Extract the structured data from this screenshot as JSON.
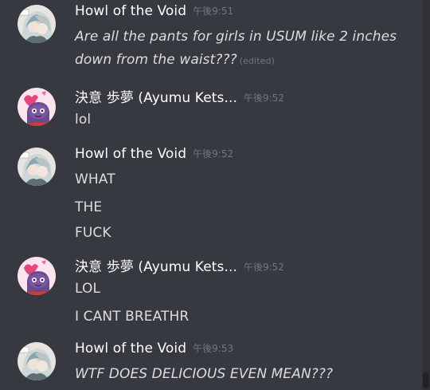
{
  "colors": {
    "background": "#36393f",
    "username": "#ffffff",
    "text": "#dcddde",
    "timestamp": "#72767d"
  },
  "messages": [
    {
      "author": "Howl of the Void",
      "avatar": "howl-avatar",
      "time": "午後9:51",
      "lines": [
        "Are all the pants for girls in USUM like 2 inches",
        "down from the waist???"
      ],
      "edited": "(edited)"
    },
    {
      "author": "決意 歩夢 (Ayumu Kets...",
      "avatar": "ayumu-avatar",
      "time": "午後9:52",
      "lines": [
        "lol"
      ]
    },
    {
      "author": "Howl of the Void",
      "avatar": "howl-avatar",
      "time": "午後9:52",
      "lines": [
        "WHAT",
        "THE",
        "FUCK"
      ]
    },
    {
      "author": "決意 歩夢 (Ayumu Kets...",
      "avatar": "ayumu-avatar",
      "time": "午後9:52",
      "lines": [
        "LOL",
        "I CANT BREATHR"
      ]
    },
    {
      "author": "Howl of the Void",
      "avatar": "howl-avatar",
      "time": "午後9:53",
      "lines": [
        "WTF DOES DELICIOUS EVEN MEAN???"
      ]
    }
  ]
}
